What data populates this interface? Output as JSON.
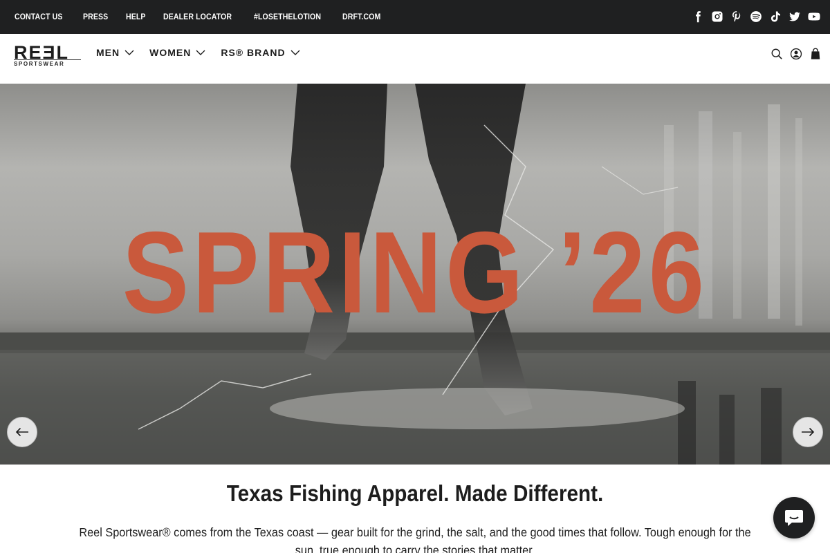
{
  "topbar": {
    "links": [
      "CONTACT US",
      "PRESS",
      "HELP",
      "DEALER LOCATOR",
      "#LOSETHELOTION",
      "DRFT.COM"
    ],
    "socials": [
      "facebook-icon",
      "instagram-icon",
      "pinterest-icon",
      "spotify-icon",
      "tiktok-icon",
      "twitter-icon",
      "youtube-icon"
    ]
  },
  "header": {
    "logo_text": "REƎL",
    "logo_sub": "SPORTSWEAR",
    "nav": [
      "MEN",
      "WOMEN",
      "RS® BRAND"
    ],
    "icons": [
      "search-icon",
      "account-icon",
      "cart-icon"
    ]
  },
  "hero": {
    "title": "SPRING ’26",
    "prev_icon": "arrow-left-icon",
    "next_icon": "arrow-right-icon",
    "title_color": "#c9593c"
  },
  "content": {
    "heading": "Texas Fishing Apparel. Made Different.",
    "description": "Reel Sportswear® comes from the Texas coast — gear built for the grind, the salt, and the good times that follow. Tough enough for the sun, true enough to carry the stories that matter."
  },
  "chat": {
    "icon": "chat-icon"
  },
  "colors": {
    "topbar_bg": "#1f2021",
    "text": "#1d1d1d",
    "accent": "#c9593c"
  }
}
